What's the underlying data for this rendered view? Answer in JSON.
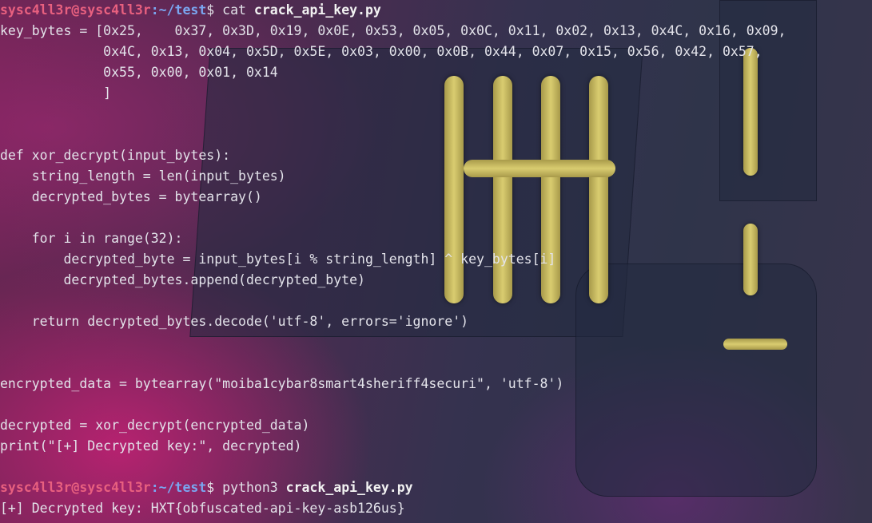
{
  "prompt": {
    "user_host": "sysc4ll3r@sysc4ll3r",
    "path": ":~/test",
    "symbol": "$ "
  },
  "commands": [
    {
      "name": "cat",
      "arg": "crack_api_key.py"
    },
    {
      "name": "python3",
      "arg": "crack_api_key.py"
    }
  ],
  "file_lines": [
    "key_bytes = [0x25,    0x37, 0x3D, 0x19, 0x0E, 0x53, 0x05, 0x0C, 0x11, 0x02, 0x13, 0x4C, 0x16, 0x09,",
    "             0x4C, 0x13, 0x04, 0x5D, 0x5E, 0x03, 0x00, 0x0B, 0x44, 0x07, 0x15, 0x56, 0x42, 0x57,",
    "             0x55, 0x00, 0x01, 0x14",
    "             ]",
    "",
    "",
    "def xor_decrypt(input_bytes):",
    "    string_length = len(input_bytes)",
    "    decrypted_bytes = bytearray()",
    "",
    "    for i in range(32):",
    "        decrypted_byte = input_bytes[i % string_length] ^ key_bytes[i]",
    "        decrypted_bytes.append(decrypted_byte)",
    "",
    "    return decrypted_bytes.decode('utf-8', errors='ignore')",
    "",
    "",
    "encrypted_data = bytearray(\"moiba1cybar8smart4sheriff4securi\", 'utf-8')",
    "",
    "decrypted = xor_decrypt(encrypted_data)",
    "print(\"[+] Decrypted key:\", decrypted)",
    ""
  ],
  "output": "[+] Decrypted key: HXT{obfuscated-api-key-asb126us}"
}
